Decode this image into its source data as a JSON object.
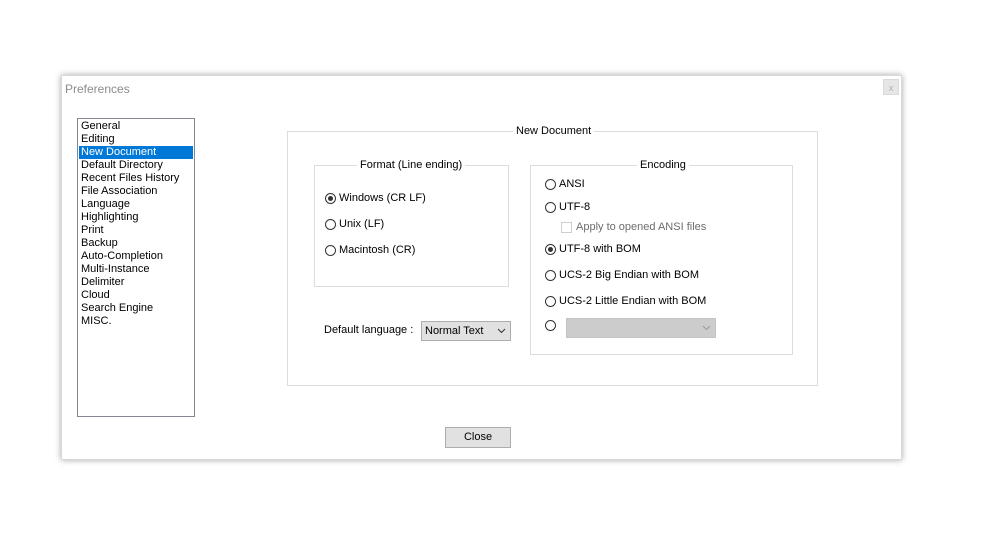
{
  "window": {
    "title": "Preferences",
    "close_glyph": "x"
  },
  "nav": {
    "items": [
      {
        "label": "General"
      },
      {
        "label": "Editing"
      },
      {
        "label": "New Document"
      },
      {
        "label": "Default Directory"
      },
      {
        "label": "Recent Files History"
      },
      {
        "label": "File Association"
      },
      {
        "label": "Language"
      },
      {
        "label": "Highlighting"
      },
      {
        "label": "Print"
      },
      {
        "label": "Backup"
      },
      {
        "label": "Auto-Completion"
      },
      {
        "label": "Multi-Instance"
      },
      {
        "label": "Delimiter"
      },
      {
        "label": "Cloud"
      },
      {
        "label": "Search Engine"
      },
      {
        "label": "MISC."
      }
    ],
    "selected": "New Document"
  },
  "panel": {
    "title": "New Document",
    "format": {
      "label": "Format (Line ending)",
      "options": [
        {
          "label": "Windows (CR LF)",
          "checked": true
        },
        {
          "label": "Unix (LF)",
          "checked": false
        },
        {
          "label": "Macintosh (CR)",
          "checked": false
        }
      ]
    },
    "encoding": {
      "label": "Encoding",
      "options": [
        {
          "label": "ANSI",
          "checked": false
        },
        {
          "label": "UTF-8",
          "checked": false
        },
        {
          "label": "UTF-8 with BOM",
          "checked": true
        },
        {
          "label": "UCS-2 Big Endian with BOM",
          "checked": false
        },
        {
          "label": "UCS-2 Little Endian with BOM",
          "checked": false
        },
        {
          "label": "",
          "checked": false
        }
      ],
      "apply_checkbox": {
        "label": "Apply to opened ANSI files",
        "checked": false,
        "enabled": false
      },
      "codepage_select": {
        "value": "",
        "enabled": false
      }
    },
    "default_language": {
      "label": "Default language :",
      "value": "Normal Text"
    }
  },
  "buttons": {
    "close": "Close"
  },
  "colors": {
    "selection": "#0078d7",
    "button_face": "#e1e1e1"
  },
  "icons": {
    "dropdown": "chevron-down-icon"
  }
}
